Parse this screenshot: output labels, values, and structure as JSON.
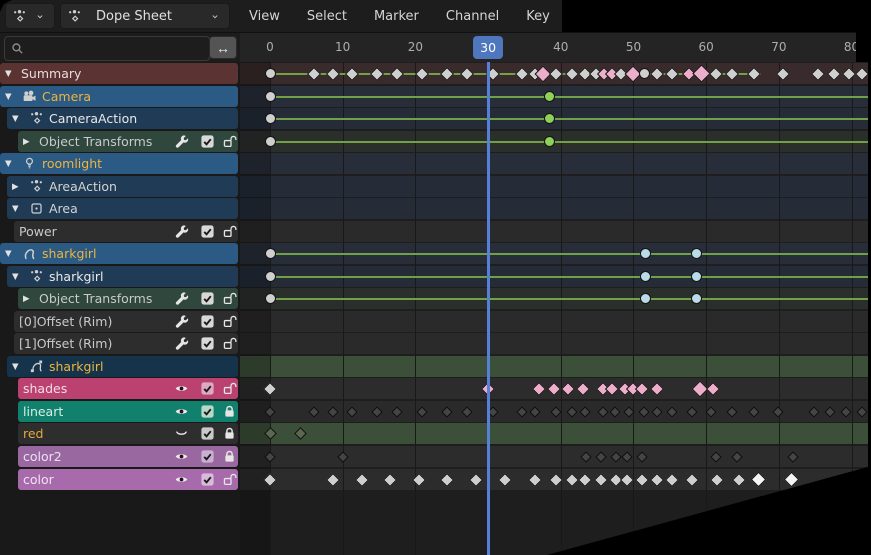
{
  "menubar": {
    "mode_label": "Dope Sheet",
    "menus": [
      "View",
      "Select",
      "Marker",
      "Channel",
      "Key"
    ]
  },
  "filter": {
    "placeholder": "",
    "value": "",
    "range_icon": "↔"
  },
  "ruler": {
    "ticks": [
      0,
      10,
      20,
      30,
      40,
      50,
      60,
      70,
      80
    ],
    "current_frame": 30
  },
  "colors": {
    "accent_blue": "#4f77bd",
    "playhead": "#5680d8",
    "key_grey": "#cfcfcf",
    "key_pink": "#ecaecb",
    "key_dark": "#454545",
    "key_green": "#8fd158",
    "key_lightblue": "#badbe8",
    "key_muted_green": "#5a6850",
    "key_bright": "#f5f5f5",
    "hold_line": "#70a146",
    "grid_line": "#191919",
    "icon_grey": "#cfcfcf",
    "lock_white": "#e6e6e6",
    "eye_light": "#f2e8ee"
  },
  "channels": [
    {
      "id": "summary",
      "label": "Summary",
      "x": 0,
      "bg": "#5b3333",
      "text": "#e8dcdc",
      "strip": "#392b2b",
      "expander": "down",
      "icon": null,
      "buttons": [],
      "lines": [
        [
          0,
          67.5
        ]
      ],
      "keys": [
        {
          "f": 0,
          "t": "c"
        },
        {
          "f": 6
        },
        {
          "f": 8.6
        },
        {
          "f": 11.3
        },
        {
          "f": 14.7
        },
        {
          "f": 17.5
        },
        {
          "f": 20.9
        },
        {
          "f": 24.3
        },
        {
          "f": 27.1
        },
        {
          "f": 30.7
        },
        {
          "f": 34.6
        },
        {
          "f": 36.4
        },
        {
          "f": 37.5,
          "c": "pink",
          "s": 12
        },
        {
          "f": 39.4
        },
        {
          "f": 41.5
        },
        {
          "f": 43.4
        },
        {
          "f": 44.9
        },
        {
          "f": 45.9,
          "c": "pink"
        },
        {
          "f": 47.1,
          "c": "pink"
        },
        {
          "f": 48.3
        },
        {
          "f": 50,
          "c": "pink",
          "s": 12
        },
        {
          "f": 51.5,
          "t": "c"
        },
        {
          "f": 53.2
        },
        {
          "f": 55.3
        },
        {
          "f": 57.7,
          "c": "pink"
        },
        {
          "f": 59.3,
          "c": "pink",
          "s": 13
        },
        {
          "f": 61.4
        },
        {
          "f": 63.6
        },
        {
          "f": 66.6
        },
        {
          "f": 70.6
        },
        {
          "f": 75.4
        },
        {
          "f": 77.6
        },
        {
          "f": 79.6
        },
        {
          "f": 81.4
        }
      ]
    },
    {
      "id": "camera",
      "label": "Camera",
      "x": 0,
      "bg": "#2b5a84",
      "text": "#edb43e",
      "strip": "#272e3a",
      "expander": "down",
      "icon": "camera",
      "buttons": [],
      "lines": [
        [
          0,
          88
        ]
      ],
      "keys": [
        {
          "f": 0,
          "t": "c"
        },
        {
          "f": 38.5,
          "t": "c",
          "c": "green"
        }
      ]
    },
    {
      "id": "camera-action",
      "label": "CameraAction",
      "x": 7,
      "bg": "#1f3b55",
      "text": "#e9e9e9",
      "strip": "#252c38",
      "expander": "down",
      "icon": "action",
      "buttons": [],
      "lines": [
        [
          0,
          88
        ]
      ],
      "keys": [
        {
          "f": 0,
          "t": "c"
        },
        {
          "f": 38.5,
          "t": "c",
          "c": "green"
        }
      ]
    },
    {
      "id": "object-transforms-camera",
      "label": "Object Transforms",
      "x": 18,
      "bg": "#2f473c",
      "text": "#c9c9c9",
      "strip": "#2b2f2c",
      "expander": "right",
      "icon": null,
      "buttons": [
        "wrench",
        "check",
        "lock-open"
      ],
      "lines": [
        [
          0,
          88
        ]
      ],
      "keys": [
        {
          "f": 0,
          "t": "c"
        },
        {
          "f": 38.5,
          "t": "c",
          "c": "green"
        }
      ]
    },
    {
      "id": "roomlight",
      "label": "roomlight",
      "x": 0,
      "bg": "#2b5a84",
      "text": "#edb43e",
      "strip": "#272e3a",
      "expander": "down",
      "icon": "light-bulb",
      "buttons": [],
      "keys": []
    },
    {
      "id": "area-action",
      "label": "AreaAction",
      "x": 7,
      "bg": "#1f3b55",
      "text": "#d4d4d4",
      "strip": "#252c38",
      "expander": "right",
      "icon": "action",
      "buttons": [],
      "keys": []
    },
    {
      "id": "area",
      "label": "Area",
      "x": 7,
      "bg": "#1f3b55",
      "text": "#d4d4d4",
      "strip": "#252c38",
      "expander": "down",
      "icon": "light-area",
      "buttons": [],
      "keys": []
    },
    {
      "id": "power",
      "label": "Power",
      "x": 14,
      "bg": "#2d2d2d",
      "text": "#c9c9c9",
      "strip": "#2a2a2a",
      "expander": null,
      "icon": null,
      "buttons": [
        "wrench",
        "check",
        "lock-open"
      ],
      "keys": []
    },
    {
      "id": "sharkgirl-object",
      "label": "sharkgirl",
      "x": 0,
      "bg": "#2b5a84",
      "text": "#edb43e",
      "strip": "#272e3a",
      "expander": "down",
      "icon": "gpencil",
      "buttons": [],
      "lines": [
        [
          0,
          88
        ]
      ],
      "keys": [
        {
          "f": 0,
          "t": "c"
        },
        {
          "f": 51.6,
          "t": "c",
          "c": "blue"
        },
        {
          "f": 58.7,
          "t": "c",
          "c": "blue"
        }
      ]
    },
    {
      "id": "sharkgirl-action",
      "label": "sharkgirl",
      "x": 7,
      "bg": "#1f3b55",
      "text": "#e9e9e9",
      "strip": "#252c38",
      "expander": "down",
      "icon": "action",
      "buttons": [],
      "lines": [
        [
          0,
          88
        ]
      ],
      "keys": [
        {
          "f": 0,
          "t": "c"
        },
        {
          "f": 51.6,
          "t": "c",
          "c": "blue"
        },
        {
          "f": 58.7,
          "t": "c",
          "c": "blue"
        }
      ]
    },
    {
      "id": "object-transforms-sharkgirl",
      "label": "Object Transforms",
      "x": 18,
      "bg": "#2f473c",
      "text": "#c9c9c9",
      "strip": "#2b2f2c",
      "expander": "right",
      "icon": null,
      "buttons": [
        "wrench",
        "check",
        "lock-open"
      ],
      "lines": [
        [
          0,
          88
        ]
      ],
      "keys": [
        {
          "f": 0,
          "t": "c"
        },
        {
          "f": 51.6,
          "t": "c",
          "c": "blue"
        },
        {
          "f": 58.7,
          "t": "c",
          "c": "blue"
        }
      ]
    },
    {
      "id": "offset-rim-0",
      "label": "[0]Offset (Rim)",
      "x": 14,
      "bg": "#2d2d2d",
      "text": "#c9c9c9",
      "strip": "#2a2a2a",
      "expander": null,
      "icon": null,
      "buttons": [
        "wrench",
        "check",
        "lock-open"
      ],
      "keys": []
    },
    {
      "id": "offset-rim-1",
      "label": "[1]Offset (Rim)",
      "x": 14,
      "bg": "#2d2d2d",
      "text": "#c9c9c9",
      "strip": "#2a2a2a",
      "expander": null,
      "icon": null,
      "buttons": [
        "wrench",
        "check",
        "lock-open"
      ],
      "keys": []
    },
    {
      "id": "sharkgirl-gpencil-data",
      "label": "sharkgirl",
      "x": 7,
      "bg": "#15344c",
      "text": "#edb43e",
      "strip": "#3c4f38",
      "expander": "down",
      "icon": "gpencil-data",
      "buttons": [],
      "keys": []
    },
    {
      "id": "shades",
      "label": "shades",
      "x": 18,
      "bg": "#bb4270",
      "text": "#f4dce8",
      "strip": "#2c2c2c",
      "expander": null,
      "icon": null,
      "buttons": [
        "eye",
        "check",
        "lock-open"
      ],
      "check_tint": "#dca8c2",
      "key_color": "pink",
      "key_size": 10,
      "keys": [
        {
          "f": 0,
          "c": "grey"
        },
        {
          "f": 30
        },
        {
          "f": 37
        },
        {
          "f": 39
        },
        {
          "f": 41
        },
        {
          "f": 43
        },
        {
          "f": 45.8
        },
        {
          "f": 47
        },
        {
          "f": 48.9
        },
        {
          "f": 49.9
        },
        {
          "f": 51.2
        },
        {
          "f": 53.2
        },
        {
          "f": 59.2,
          "s": 12
        },
        {
          "f": 60.9
        }
      ]
    },
    {
      "id": "lineart",
      "label": "lineart",
      "x": 18,
      "bg": "#11806c",
      "text": "#d5efe7",
      "strip": "#2a2a2a",
      "expander": null,
      "icon": null,
      "buttons": [
        "eye",
        "check",
        "lock-closed"
      ],
      "check_tint": "#b8d8c8",
      "key_color": "dark",
      "key_size": 8,
      "keys": [
        {
          "f": 0
        },
        {
          "f": 6
        },
        {
          "f": 8.6
        },
        {
          "f": 11.3
        },
        {
          "f": 14.7
        },
        {
          "f": 17.5
        },
        {
          "f": 20.9
        },
        {
          "f": 24.3
        },
        {
          "f": 27.1
        },
        {
          "f": 30.7
        },
        {
          "f": 34.6
        },
        {
          "f": 36.4
        },
        {
          "f": 39.4
        },
        {
          "f": 41.5
        },
        {
          "f": 43.4
        },
        {
          "f": 45.8
        },
        {
          "f": 47.5
        },
        {
          "f": 49.4
        },
        {
          "f": 51.5
        },
        {
          "f": 53.2
        },
        {
          "f": 55.3
        },
        {
          "f": 58
        },
        {
          "f": 60.6
        },
        {
          "f": 63.6
        },
        {
          "f": 66.6
        },
        {
          "f": 69.9
        },
        {
          "f": 74.8
        },
        {
          "f": 77.1
        },
        {
          "f": 79.2
        },
        {
          "f": 81.4
        }
      ]
    },
    {
      "id": "red",
      "label": "red",
      "x": 18,
      "bg": "#2e2e2e",
      "text": "#e2aa3c",
      "strip": "#3c4f38",
      "expander": null,
      "icon": null,
      "buttons": [
        "eye-closed",
        "check",
        "lock-closed"
      ],
      "check_tint": "#c9c9c9",
      "key_color": "muted",
      "key_size": 9,
      "keys": [
        {
          "f": 0
        },
        {
          "f": 4.2
        }
      ]
    },
    {
      "id": "color2",
      "label": "color2",
      "x": 18,
      "bg": "#9a68a0",
      "text": "#eedff2",
      "strip": "#2c2c2c",
      "expander": null,
      "icon": null,
      "buttons": [
        "eye",
        "check",
        "lock-closed"
      ],
      "check_tint": "#cab0d0",
      "key_color": "dark",
      "key_size": 8,
      "keys": [
        {
          "f": 0
        },
        {
          "f": 10
        },
        {
          "f": 43.5
        },
        {
          "f": 45.6
        },
        {
          "f": 47.6
        },
        {
          "f": 49.1
        },
        {
          "f": 51.2
        },
        {
          "f": 61.3
        },
        {
          "f": 64.2
        },
        {
          "f": 71.9
        }
      ]
    },
    {
      "id": "color",
      "label": "color",
      "x": 18,
      "bg": "#a76aab",
      "text": "#f0e3f3",
      "strip": "#2c2c2c",
      "expander": null,
      "icon": null,
      "buttons": [
        "eye",
        "check",
        "lock-open"
      ],
      "check_tint": "#d8bada",
      "key_color": "grey",
      "key_size": 10,
      "keys": [
        {
          "f": 0
        },
        {
          "f": 8.6
        },
        {
          "f": 12.6
        },
        {
          "f": 16.5
        },
        {
          "f": 20.5
        },
        {
          "f": 24.3
        },
        {
          "f": 28.3
        },
        {
          "f": 32.3
        },
        {
          "f": 36.4
        },
        {
          "f": 39.4
        },
        {
          "f": 41.5
        },
        {
          "f": 43.4
        },
        {
          "f": 45.6
        },
        {
          "f": 47.6
        },
        {
          "f": 49.1
        },
        {
          "f": 51.2
        },
        {
          "f": 53.2
        },
        {
          "f": 55.3
        },
        {
          "f": 58
        },
        {
          "f": 61.5
        },
        {
          "f": 64.5
        },
        {
          "f": 67.2,
          "c": "bright",
          "s": 11
        },
        {
          "f": 71.8,
          "c": "bright",
          "s": 11
        }
      ]
    }
  ]
}
